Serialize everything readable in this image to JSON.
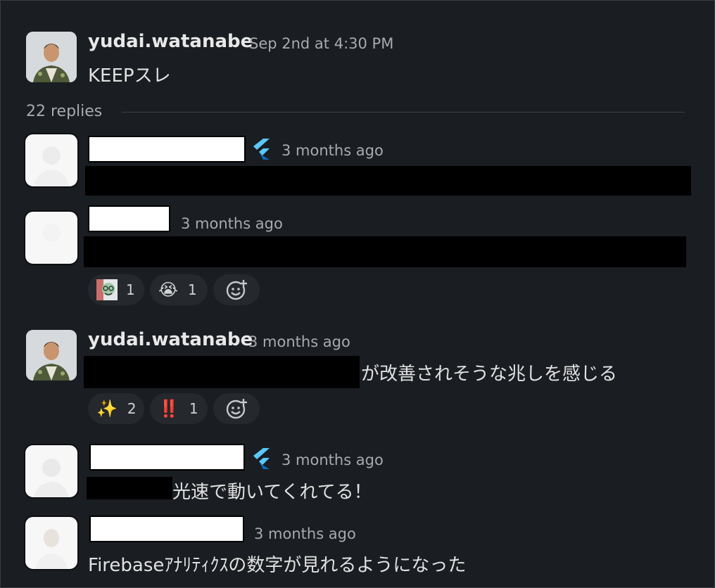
{
  "thread": {
    "parent": {
      "author": "yudai.watanabe",
      "timestamp": "Sep 2nd at 4:30 PM",
      "text": "KEEPスレ"
    },
    "replies_count": "22 replies",
    "replies": [
      {
        "timestamp": "3 months ago",
        "has_flutter_badge": true
      },
      {
        "timestamp": "3 months ago",
        "reactions": [
          {
            "emoji": "custom-avatar",
            "count": "1"
          },
          {
            "emoji": "😭",
            "count": "1"
          }
        ]
      },
      {
        "author": "yudai.watanabe",
        "timestamp": "3 months ago",
        "text_suffix": "が改善されそうな兆しを感じる",
        "reactions": [
          {
            "emoji": "✨",
            "count": "2"
          },
          {
            "emoji": "‼️",
            "count": "1"
          }
        ]
      },
      {
        "timestamp": "3 months ago",
        "has_flutter_badge": true,
        "text_suffix": "光速で動いてくれてる！"
      },
      {
        "timestamp": "3 months ago",
        "text": "Firebaseｱﾅﾘﾃｨｸｽの数字が見れるようになった"
      }
    ]
  },
  "colors": {
    "background": "#1a1d21",
    "reaction_bg": "#25282c",
    "flutter_light": "#5ac8fa",
    "flutter_dark": "#0d6ab8"
  }
}
